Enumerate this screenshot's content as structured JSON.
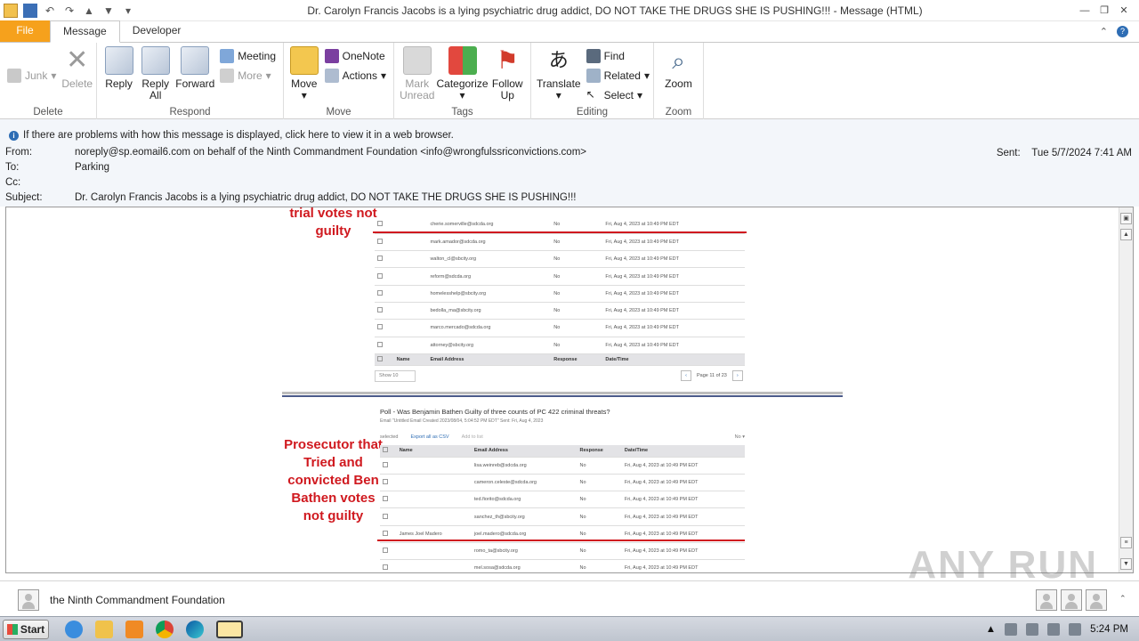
{
  "window": {
    "title": "Dr. Carolyn Francis Jacobs is a lying psychiatric drug addict, DO NOT TAKE THE DRUGS SHE IS PUSHING!!! - Message (HTML)"
  },
  "tabs": [
    {
      "label": "File"
    },
    {
      "label": "Message"
    },
    {
      "label": "Developer"
    }
  ],
  "ribbon": {
    "delete_group": {
      "label": "Delete",
      "junk": "Junk",
      "delete": "Delete"
    },
    "respond_group": {
      "label": "Respond",
      "reply": "Reply",
      "reply_all_1": "Reply",
      "reply_all_2": "All",
      "forward": "Forward",
      "meeting": "Meeting",
      "more": "More"
    },
    "move_group": {
      "label": "Move",
      "move": "Move",
      "onenote": "OneNote",
      "actions": "Actions"
    },
    "tags_group": {
      "label": "Tags",
      "mark_unread_1": "Mark",
      "mark_unread_2": "Unread",
      "categorize": "Categorize",
      "follow_up_1": "Follow",
      "follow_up_2": "Up"
    },
    "editing_group": {
      "label": "Editing",
      "translate": "Translate",
      "find": "Find",
      "related": "Related",
      "select": "Select"
    },
    "zoom_group": {
      "label": "Zoom",
      "zoom": "Zoom"
    }
  },
  "message": {
    "info": "If there are problems with how this message is displayed, click here to view it in a web browser.",
    "from_label": "From:",
    "from": "noreply@sp.eomail6.com on behalf of the Ninth Commandment Foundation <info@wrongfulssriconvictions.com>",
    "to_label": "To:",
    "to": "Parking",
    "cc_label": "Cc:",
    "subject_label": "Subject:",
    "subject": "Dr. Carolyn Francis Jacobs is a lying psychiatric drug addict, DO NOT TAKE THE DRUGS SHE IS PUSHING!!!",
    "sent_label": "Sent:",
    "sent": "Tue 5/7/2024 7:41 AM"
  },
  "body": {
    "annotation_top": [
      "trial votes not",
      "guilty"
    ],
    "annotation_mid": [
      "Prosecutor that",
      "Tried and",
      "convicted Ben",
      "Bathen votes",
      "not guilty"
    ],
    "table1": {
      "rows": [
        {
          "email": "cherie.somerville@sdcda.org",
          "response": "No",
          "date": "Fri, Aug 4, 2023 at 10:49 PM EDT"
        },
        {
          "email": "mark.amador@sdcda.org",
          "response": "No",
          "date": "Fri, Aug 4, 2023 at 10:49 PM EDT"
        },
        {
          "email": "walton_cl@sbcity.org",
          "response": "No",
          "date": "Fri, Aug 4, 2023 at 10:49 PM EDT"
        },
        {
          "email": "reform@sdcda.org",
          "response": "No",
          "date": "Fri, Aug 4, 2023 at 10:49 PM EDT"
        },
        {
          "email": "homelesshelp@sbcity.org",
          "response": "No",
          "date": "Fri, Aug 4, 2023 at 10:49 PM EDT"
        },
        {
          "email": "bedolla_ma@sbcity.org",
          "response": "No",
          "date": "Fri, Aug 4, 2023 at 10:49 PM EDT"
        },
        {
          "email": "marco.mercado@sdcda.org",
          "response": "No",
          "date": "Fri, Aug 4, 2023 at 10:49 PM EDT"
        },
        {
          "email": "attorney@sbcity.org",
          "response": "No",
          "date": "Fri, Aug 4, 2023 at 10:49 PM EDT"
        }
      ],
      "header": {
        "name": "Name",
        "email": "Email Address",
        "response": "Response",
        "date": "Date/Time"
      },
      "show": "Show 10",
      "page": "Page 11 of 23"
    },
    "table2": {
      "title": "Poll - Was Benjamin Bathen Guilty of three counts of PC 422 criminal threats?",
      "subtitle": "Email \"Untitled Email Created 2023/08/04, 5:04:52 PM EDT\" Sent: Fri, Aug 4, 2023",
      "selected": "selected",
      "export": "Export all as CSV",
      "add_to_list": "Add to list",
      "filter": "No",
      "header": {
        "name": "Name",
        "email": "Email Address",
        "response": "Response",
        "date": "Date/Time"
      },
      "rows": [
        {
          "name": "",
          "email": "lisa.weinreb@sdcda.org",
          "response": "No",
          "date": "Fri, Aug 4, 2023 at 10:49 PM EDT"
        },
        {
          "name": "",
          "email": "cameron.celeste@sdcda.org",
          "response": "No",
          "date": "Fri, Aug 4, 2023 at 10:49 PM EDT"
        },
        {
          "name": "",
          "email": "ted.fiorito@sdcda.org",
          "response": "No",
          "date": "Fri, Aug 4, 2023 at 10:49 PM EDT"
        },
        {
          "name": "",
          "email": "sanchez_th@sbcity.org",
          "response": "No",
          "date": "Fri, Aug 4, 2023 at 10:49 PM EDT"
        },
        {
          "name": "James Joel Madero",
          "email": "joel.madero@sdcda.org",
          "response": "No",
          "date": "Fri, Aug 4, 2023 at 10:49 PM EDT"
        },
        {
          "name": "",
          "email": "romo_ta@sbcity.org",
          "response": "No",
          "date": "Fri, Aug 4, 2023 at 10:49 PM EDT"
        },
        {
          "name": "",
          "email": "mel.sosa@sdcda.org",
          "response": "No",
          "date": "Fri, Aug 4, 2023 at 10:49 PM EDT"
        }
      ]
    }
  },
  "people": {
    "name": "the Ninth Commandment Foundation"
  },
  "taskbar": {
    "start": "Start",
    "time": "5:24 PM"
  },
  "watermark": "ANY RUN",
  "colors": {
    "file_tab": "#f6a11c",
    "annotation": "#d0191f",
    "info_bg": "#f3f6fa"
  }
}
